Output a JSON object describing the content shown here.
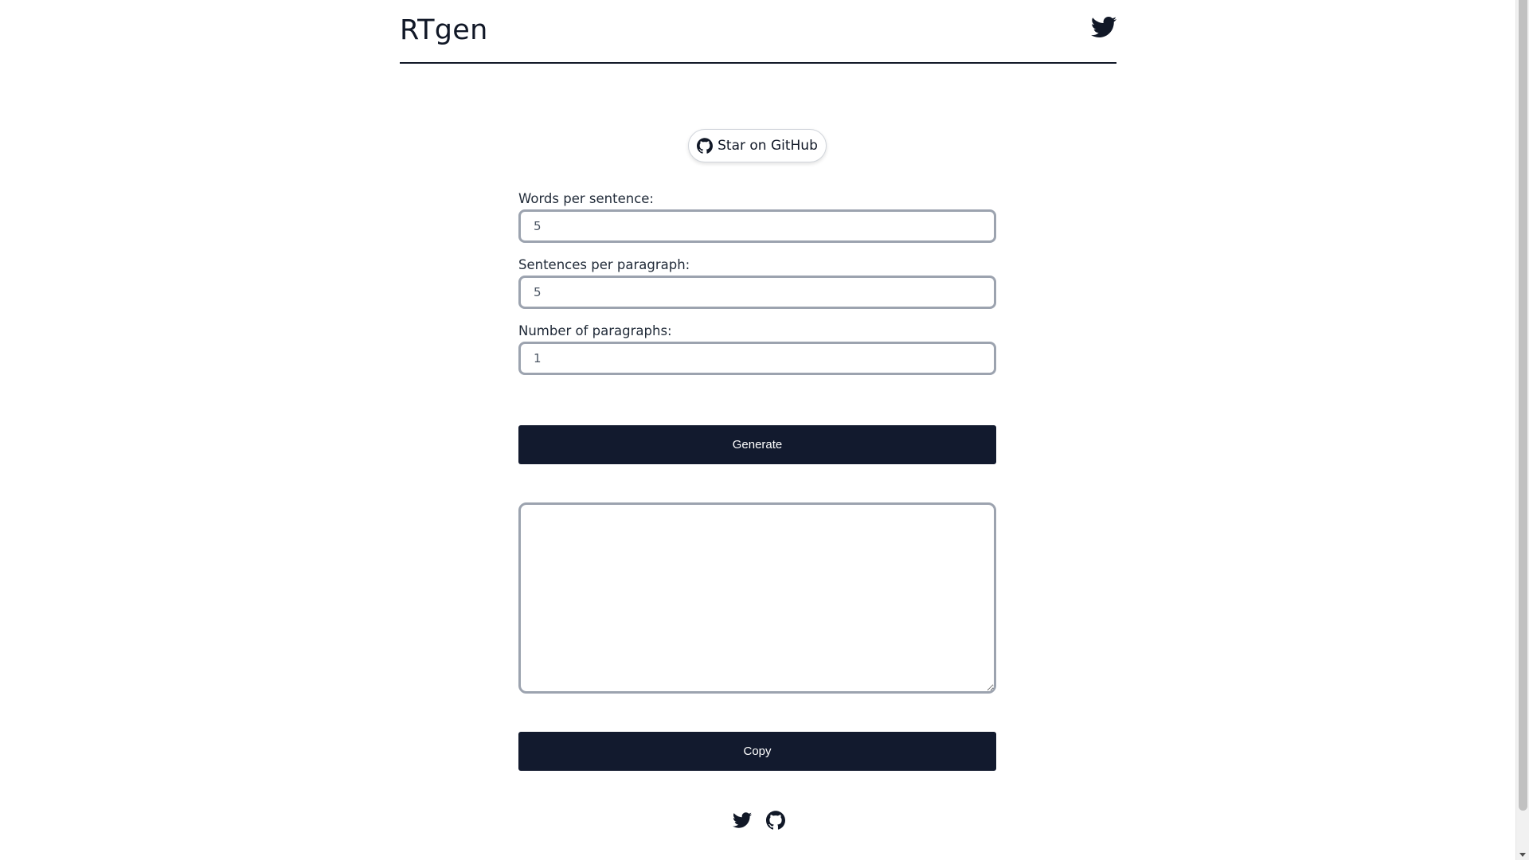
{
  "header": {
    "brand": "RTgen",
    "twitter_icon": "twitter-icon"
  },
  "star_button": {
    "label": "Star on GitHub",
    "icon": "github-icon"
  },
  "form": {
    "words_per_sentence": {
      "label": "Words per sentence:",
      "value": "5"
    },
    "sentences_per_paragraph": {
      "label": "Sentences per paragraph:",
      "value": "5"
    },
    "number_of_paragraphs": {
      "label": "Number of paragraphs:",
      "value": "1"
    }
  },
  "actions": {
    "generate_label": "Generate",
    "copy_label": "Copy"
  },
  "output": {
    "value": ""
  },
  "footer": {
    "icons": [
      "twitter-icon",
      "github-icon"
    ]
  },
  "colors": {
    "primary_dark": "#121a2e",
    "input_border": "#9ca3af",
    "text": "#111827"
  }
}
